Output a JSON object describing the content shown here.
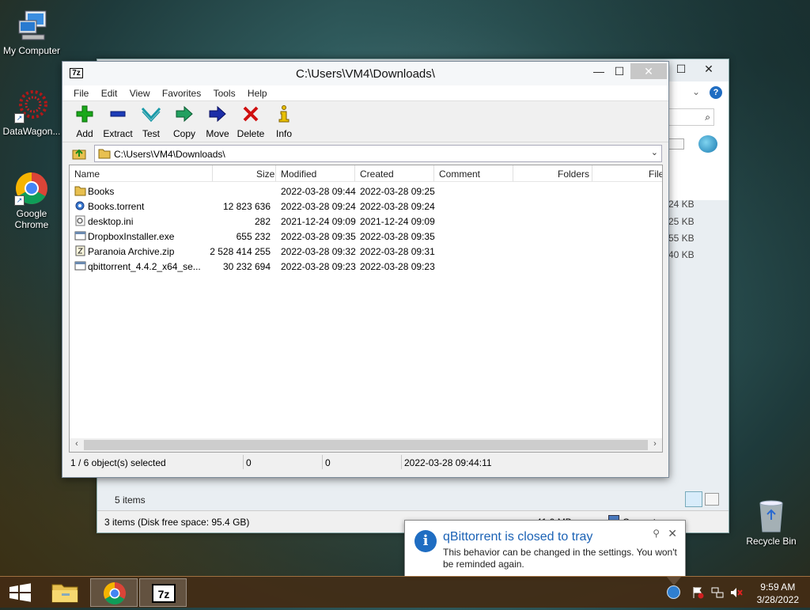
{
  "desktop": {
    "icons": [
      {
        "label": "My Computer"
      },
      {
        "label": "DataWagon..."
      },
      {
        "label": "Google Chrome"
      },
      {
        "label": "Recycle Bin"
      }
    ]
  },
  "explorer_bg": {
    "sizes": [
      "24 KB",
      "25 KB",
      "55 KB",
      "40 KB"
    ],
    "items_count": "5 items",
    "status_left": "3 items (Disk free space: 95.4 GB)",
    "status_size": "41.0 MB",
    "status_location": "Computer"
  },
  "window": {
    "title": "C:\\Users\\VM4\\Downloads\\",
    "app_icon": "7z",
    "minimize": "—",
    "maximize": "☐",
    "close": "✕"
  },
  "menu": [
    "File",
    "Edit",
    "View",
    "Favorites",
    "Tools",
    "Help"
  ],
  "toolbar": [
    {
      "label": "Add",
      "icon": "plus-icon",
      "color": "#1aa81a"
    },
    {
      "label": "Extract",
      "icon": "minus-icon",
      "color": "#1d3db8"
    },
    {
      "label": "Test",
      "icon": "check-down-icon",
      "color": "#1a9aa8"
    },
    {
      "label": "Copy",
      "icon": "copy-arrow-icon",
      "color": "#22a060"
    },
    {
      "label": "Move",
      "icon": "move-arrow-icon",
      "color": "#1d2ea8"
    },
    {
      "label": "Delete",
      "icon": "x-icon",
      "color": "#d01010"
    },
    {
      "label": "Info",
      "icon": "info-icon",
      "color": "#c8a000"
    }
  ],
  "address": {
    "path": "C:\\Users\\VM4\\Downloads\\"
  },
  "columns": [
    "Name",
    "Size",
    "Modified",
    "Created",
    "Comment",
    "Folders",
    "File"
  ],
  "files": [
    {
      "name": "Books",
      "size": "",
      "modified": "2022-03-28 09:44",
      "created": "2022-03-28 09:25",
      "type": "folder"
    },
    {
      "name": "Books.torrent",
      "size": "12 823 636",
      "modified": "2022-03-28 09:24",
      "created": "2022-03-28 09:24",
      "type": "torrent"
    },
    {
      "name": "desktop.ini",
      "size": "282",
      "modified": "2021-12-24 09:09",
      "created": "2021-12-24 09:09",
      "type": "ini"
    },
    {
      "name": "DropboxInstaller.exe",
      "size": "655 232",
      "modified": "2022-03-28 09:35",
      "created": "2022-03-28 09:35",
      "type": "exe"
    },
    {
      "name": "Paranoia Archive.zip",
      "size": "2 528 414 255",
      "modified": "2022-03-28 09:32",
      "created": "2022-03-28 09:31",
      "type": "zip"
    },
    {
      "name": "qbittorrent_4.4.2_x64_se...",
      "size": "30 232 694",
      "modified": "2022-03-28 09:23",
      "created": "2022-03-28 09:23",
      "type": "exe"
    }
  ],
  "status": {
    "selected": "1 / 6 object(s) selected",
    "size1": "0",
    "size2": "0",
    "datetime": "2022-03-28 09:44:11"
  },
  "notification": {
    "title": "qBittorrent is closed to tray",
    "body": "This behavior can be changed in the settings. You won't be reminded again."
  },
  "taskbar": {
    "time": "9:59 AM",
    "date": "3/28/2022"
  }
}
